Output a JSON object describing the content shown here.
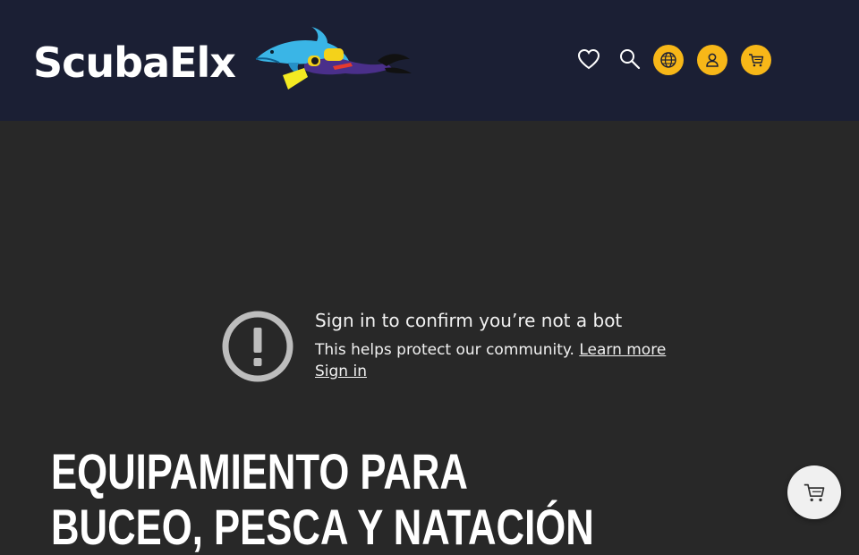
{
  "header": {
    "logo_text": "ScubaElx",
    "mascot_icon": "dolphin-diver-icon",
    "icons": [
      "heart-icon",
      "search-icon",
      "globe-icon",
      "user-icon",
      "cart-icon"
    ],
    "accent_color": "#f7b718",
    "background_color": "#1b1f34"
  },
  "bot_check": {
    "title": "Sign in to confirm you’re not a bot",
    "description": "This helps protect our community.",
    "learn_more": "Learn more",
    "sign_in": "Sign in",
    "icon": "alert-circle-icon"
  },
  "hero": {
    "line1": "EQUIPAMIENTO PARA",
    "line2": "BUCEO, PESCA Y NATACIÓN"
  },
  "floating_cart": {
    "icon": "cart-icon"
  }
}
